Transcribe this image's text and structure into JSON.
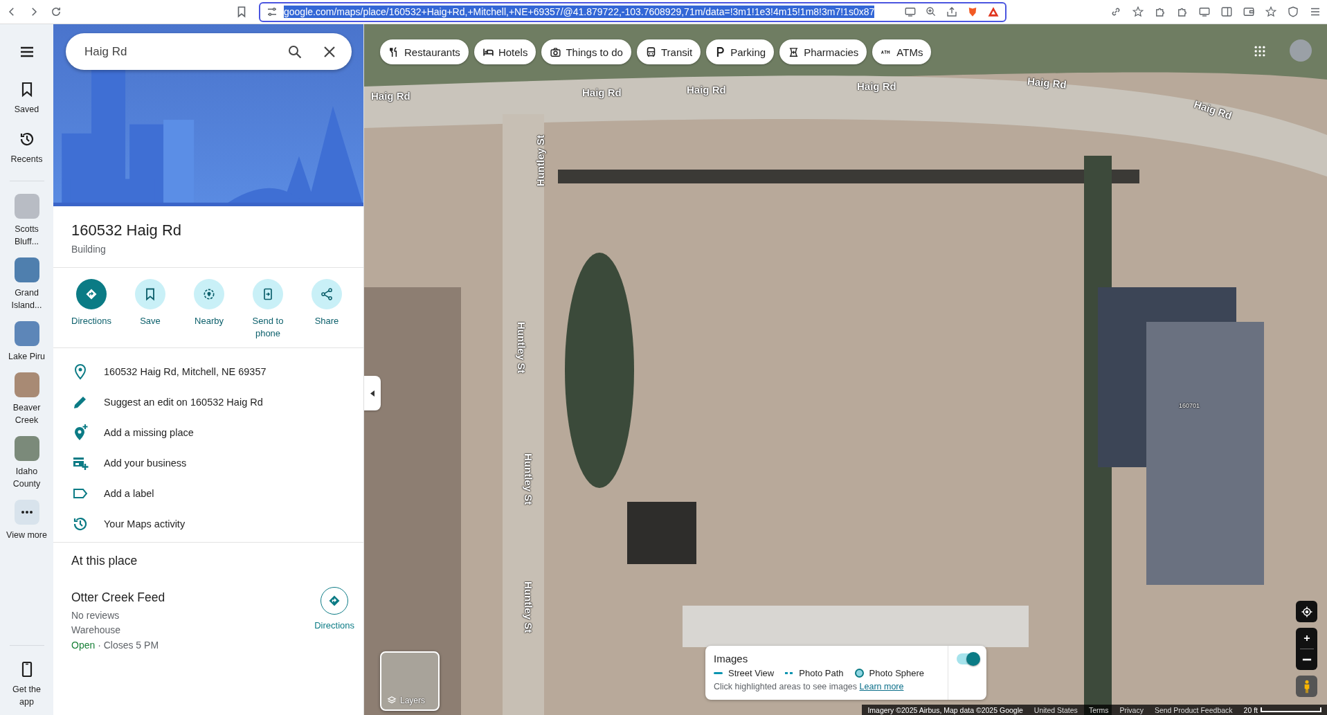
{
  "browser": {
    "url": "google.com/maps/place/160532+Haig+Rd,+Mitchell,+NE+69357/@41.879722,-103.7608929,71m/data=!3m1!1e3!4m15!1m8!3m7!1s0x87",
    "url_selected": true
  },
  "rail": {
    "items": [
      {
        "kind": "icon",
        "label": "Saved"
      },
      {
        "kind": "icon",
        "label": "Recents"
      },
      {
        "kind": "thumb",
        "label": "Scotts Bluff..."
      },
      {
        "kind": "thumb",
        "label": "Grand Island..."
      },
      {
        "kind": "thumb",
        "label": "Lake Piru"
      },
      {
        "kind": "thumb",
        "label": "Beaver Creek"
      },
      {
        "kind": "thumb",
        "label": "Idaho County"
      },
      {
        "kind": "more",
        "label": "View more"
      }
    ],
    "footer": {
      "label": "Get the app"
    }
  },
  "search": {
    "value": "Haig Rd"
  },
  "place": {
    "title": "160532 Haig Rd",
    "category": "Building",
    "actions": [
      {
        "label": "Directions",
        "primary": true
      },
      {
        "label": "Save",
        "primary": false
      },
      {
        "label": "Nearby",
        "primary": false
      },
      {
        "label": "Send to phone",
        "primary": false
      },
      {
        "label": "Share",
        "primary": false
      }
    ],
    "rows": [
      {
        "text": "160532 Haig Rd, Mitchell, NE 69357"
      },
      {
        "text": "Suggest an edit on 160532 Haig Rd"
      },
      {
        "text": "Add a missing place"
      },
      {
        "text": "Add your business"
      },
      {
        "text": "Add a label"
      },
      {
        "text": "Your Maps activity"
      }
    ]
  },
  "at_this_place": {
    "heading": "At this place",
    "places": [
      {
        "name": "Otter Creek Feed",
        "reviews": "No reviews",
        "category": "Warehouse",
        "status": "Open",
        "hours": "· Closes 5 PM",
        "action": "Directions"
      }
    ]
  },
  "map": {
    "chips": [
      {
        "label": "Restaurants"
      },
      {
        "label": "Hotels"
      },
      {
        "label": "Things to do"
      },
      {
        "label": "Transit"
      },
      {
        "label": "Parking"
      },
      {
        "label": "Pharmacies"
      },
      {
        "label": "ATMs"
      }
    ],
    "labels": [
      {
        "kind": "road",
        "text": "Haig Rd"
      },
      {
        "kind": "road",
        "text": "Haig Rd"
      },
      {
        "kind": "road",
        "text": "Haig Rd"
      },
      {
        "kind": "road",
        "text": "Haig Rd"
      },
      {
        "kind": "road",
        "text": "Haig Rd"
      },
      {
        "kind": "road",
        "text": "Haig Rd"
      },
      {
        "kind": "street",
        "text": "Huntley St"
      },
      {
        "kind": "street",
        "text": "Huntley St"
      },
      {
        "kind": "street",
        "text": "Huntley St"
      },
      {
        "kind": "street",
        "text": "Huntley St"
      },
      {
        "kind": "number",
        "text": "160701"
      }
    ],
    "layers": {
      "label": "Layers"
    },
    "images": {
      "title": "Images",
      "on": true,
      "legend": [
        {
          "kind": "line",
          "label": "Street View"
        },
        {
          "kind": "dashed",
          "label": "Photo Path"
        },
        {
          "kind": "circle",
          "label": "Photo Sphere"
        }
      ],
      "hint": "Click highlighted areas to see images",
      "link": "Learn more"
    },
    "footer": [
      "Imagery ©2025 Airbus, Map data ©2025 Google",
      "United States",
      "Terms",
      "Privacy",
      "Send Product Feedback"
    ],
    "scale": "20 ft"
  }
}
